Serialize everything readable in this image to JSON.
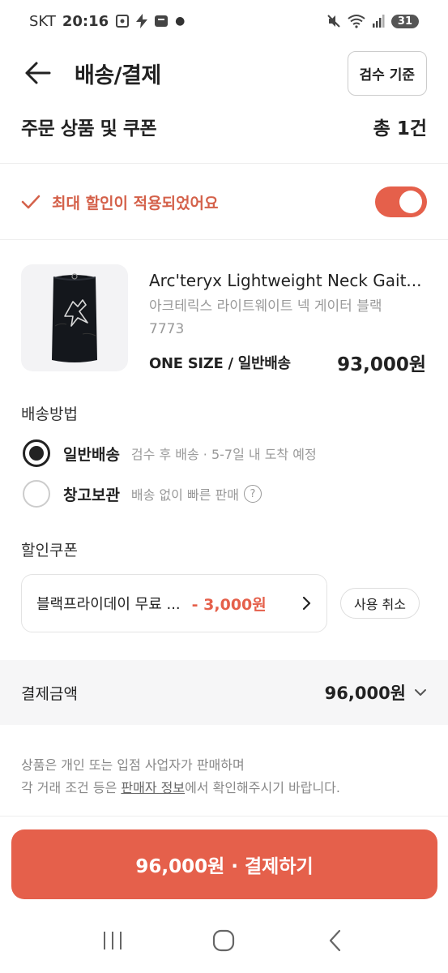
{
  "status_bar": {
    "carrier": "SKT",
    "time": "20:16",
    "battery": "31"
  },
  "header": {
    "title": "배송/결제",
    "inspect_button": "검수 기준"
  },
  "order": {
    "title": "주문 상품 및 쿠폰",
    "count": "총 1건"
  },
  "discount": {
    "text": "최대 할인이 적용되었어요",
    "enabled": true
  },
  "product": {
    "name": "Arc'teryx Lightweight Neck Gait...",
    "sub_name_line1": "아크테릭스 라이트웨이트 넥 게이터 블랙",
    "sub_name_line2": "7773",
    "option": "ONE SIZE / 일반배송",
    "price": "93,000원"
  },
  "shipping": {
    "label": "배송방법",
    "options": [
      {
        "label": "일반배송",
        "desc": "검수 후 배송 · 5-7일 내 도착 예정",
        "selected": true
      },
      {
        "label": "창고보관",
        "desc": "배송 없이 빠른 판매",
        "selected": false
      }
    ]
  },
  "coupon": {
    "label": "할인쿠폰",
    "name": "블랙프라이데이 무료 ...",
    "amount": "- 3,000원",
    "cancel_button": "사용 취소"
  },
  "payment": {
    "label": "결제금액",
    "amount": "96,000원"
  },
  "notice": {
    "line1": "상품은 개인 또는 입점 사업자가 판매하며",
    "line2_prefix": "각 거래 조건 등은 ",
    "line2_link": "판매자 정보",
    "line2_suffix": "에서 확인해주시기 바랍니다."
  },
  "pay_button": "96,000원 · 결제하기",
  "colors": {
    "accent": "#e5604b",
    "discount_text": "#d4614a"
  }
}
